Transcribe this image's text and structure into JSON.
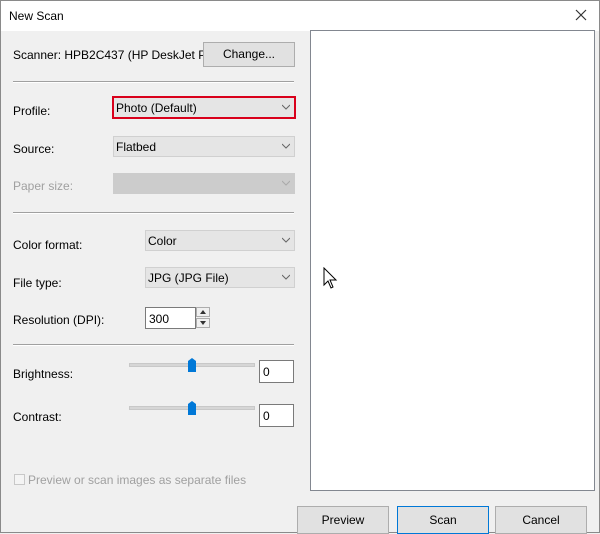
{
  "window": {
    "title": "New Scan"
  },
  "scanner": {
    "label": "Scanner: HPB2C437 (HP DeskJet Pl...",
    "change_button": "Change..."
  },
  "profile": {
    "label": "Profile:",
    "value": "Photo (Default)"
  },
  "source": {
    "label": "Source:",
    "value": "Flatbed"
  },
  "paper_size": {
    "label": "Paper size:",
    "value": ""
  },
  "color_format": {
    "label": "Color format:",
    "value": "Color"
  },
  "file_type": {
    "label": "File type:",
    "value": "JPG (JPG File)"
  },
  "resolution": {
    "label": "Resolution (DPI):",
    "value": "300"
  },
  "brightness": {
    "label": "Brightness:",
    "value": "0",
    "slider_fraction": 0.5
  },
  "contrast": {
    "label": "Contrast:",
    "value": "0",
    "slider_fraction": 0.5
  },
  "separate_files": {
    "label": "Preview or scan images as separate files",
    "checked": false
  },
  "buttons": {
    "preview": "Preview",
    "scan": "Scan",
    "cancel": "Cancel"
  },
  "colors": {
    "highlight": "#d9001b",
    "accent": "#0078d7",
    "slider_thumb": "#0078d7"
  },
  "icons": {
    "close": "close-icon",
    "dropdown": "chevron-down-icon",
    "cursor": "mouse-pointer-icon"
  }
}
